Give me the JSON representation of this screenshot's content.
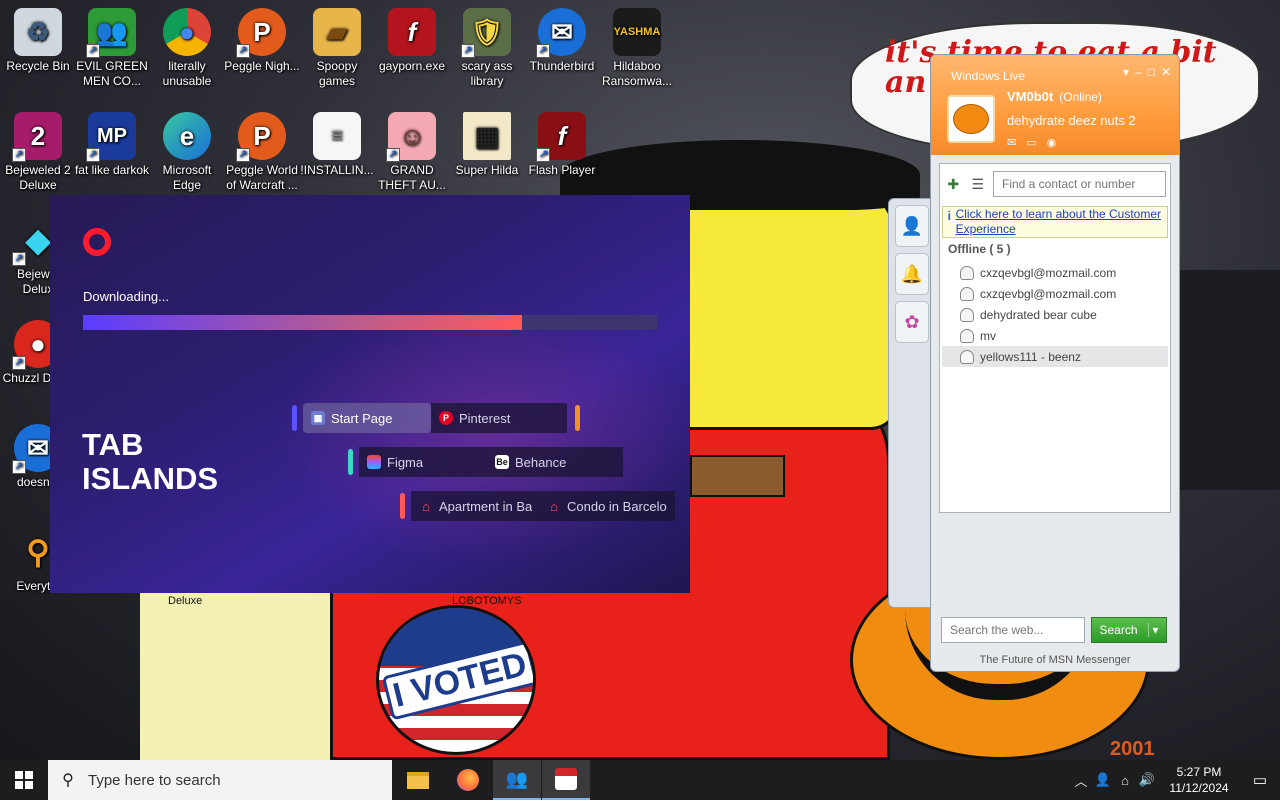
{
  "wallpaper": {
    "speech_text": "it's time to eat a bit an ck or",
    "badge_text": "I VOTED",
    "label_deluxe": "Deluxe",
    "label_lobotomys": "LOBOTOMYS",
    "label_2001": "2001"
  },
  "desktop_icons": [
    {
      "label": "Recycle Bin",
      "icon": "recycle-bin-icon"
    },
    {
      "label": "EVIL GREEN MEN CO...",
      "icon": "messenger-men-icon"
    },
    {
      "label": "literally unusable",
      "icon": "chrome-icon"
    },
    {
      "label": "Peggle Nigh...",
      "icon": "peggle-icon"
    },
    {
      "label": "Spoopy games",
      "icon": "folder-icon"
    },
    {
      "label": "gayporn.exe",
      "icon": "flash-icon"
    },
    {
      "label": "scary ass library",
      "icon": "library-icon"
    },
    {
      "label": "Thunderbird",
      "icon": "thunderbird-icon"
    },
    {
      "label": "Hildaboo Ransomwa...",
      "icon": "shield-icon"
    },
    {
      "label": "Bejeweled 2 Deluxe",
      "icon": "bejeweled-icon"
    },
    {
      "label": "fat like darkok",
      "icon": "mpc-icon"
    },
    {
      "label": "Microsoft Edge",
      "icon": "edge-icon"
    },
    {
      "label": "Peggle World of Warcraft ...",
      "icon": "peggle-icon"
    },
    {
      "label": "!INSTALLIN...",
      "icon": "document-icon"
    },
    {
      "label": "GRAND THEFT AU...",
      "icon": "anime-girl-icon"
    },
    {
      "label": "Super Hilda",
      "icon": "pixel-hilda-icon"
    },
    {
      "label": "Flash Player",
      "icon": "flash-icon"
    },
    {
      "label": "Bejewel Delux",
      "icon": "diamond-icon"
    },
    {
      "label": "Chuzzl Delux",
      "icon": "chuzzle-icon"
    },
    {
      "label": "doesnt l",
      "icon": "thunderbird-icon"
    },
    {
      "label": "Everythi",
      "icon": "everything-search-icon"
    }
  ],
  "opera": {
    "status": "Downloading...",
    "progress": 0.765,
    "headline_line1": "TAB",
    "headline_line2": "ISLANDS",
    "tabs_row1": [
      "Start Page",
      "Pinterest"
    ],
    "tabs_row2": [
      "Figma",
      "Behance"
    ],
    "tabs_row3": [
      "Apartment in Ba",
      "Condo in Barcelo"
    ],
    "behance_badge": "Be"
  },
  "messenger": {
    "title": "Windows Live",
    "username": "VM0b0t",
    "status": "(Online)",
    "psm": "dehydrate deez nuts 2",
    "search_placeholder": "Find a contact or number",
    "info_link": "Click here to learn about the Customer Experience",
    "group_label": "Offline ( 5 )",
    "contacts": [
      "cxzqevbgl@mozmail.com",
      "cxzqevbgl@mozmail.com",
      "dehydrated bear cube",
      "mv",
      "yellows111 - beenz"
    ],
    "web_search_placeholder": "Search the web...",
    "search_button": "Search",
    "footer": "The Future of MSN Messenger"
  },
  "taskbar": {
    "search_placeholder": "Type here to search",
    "time": "5:27 PM",
    "date": "11/12/2024",
    "apps": [
      "file-explorer-icon",
      "firefox-icon",
      "messenger-icon",
      "installer-icon"
    ]
  },
  "colors": {
    "opera_red": "#ff1b2d",
    "wlm_orange": "#ff9c3e",
    "search_green": "#2d9a2a",
    "taskbar": "#1d1d1f"
  }
}
